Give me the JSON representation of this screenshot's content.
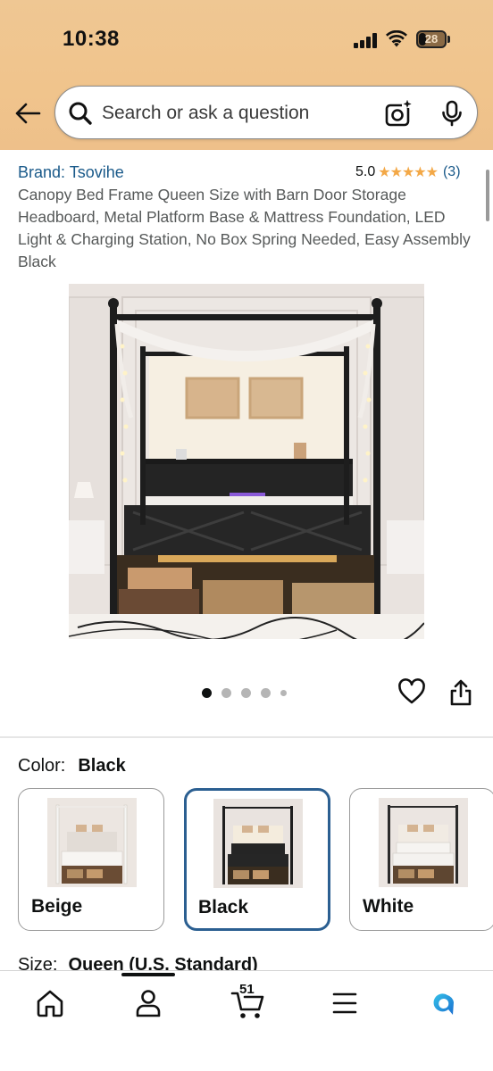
{
  "status_bar": {
    "time": "10:38",
    "battery": "28",
    "battery_level_percent": 28
  },
  "search": {
    "placeholder": "Search or ask a question"
  },
  "product": {
    "brand": "Brand: Tsovihe",
    "rating_value": "5.0",
    "rating_stars": "★★★★★",
    "rating_count": "(3)",
    "title": "Canopy Bed Frame Queen Size with Barn Door Storage Headboard, Metal Platform Base & Mattress Foundation, LED Light & Charging Station, No Box Spring Needed, Easy Assembly Black"
  },
  "carousel": {
    "total_images": 5,
    "active_index": 0
  },
  "color": {
    "label": "Color:",
    "selected": "Black",
    "options": [
      {
        "label": "Beige"
      },
      {
        "label": "Black"
      },
      {
        "label": "White"
      }
    ]
  },
  "size": {
    "label": "Size:",
    "selected": "Queen (U.S. Standard)"
  },
  "bottom_nav": {
    "cart_count": "51"
  },
  "colors": {
    "header": "#efc793",
    "link": "#1a5a8a",
    "star": "#f3a847",
    "selected_border": "#2b5f91",
    "alexa": "#1a8fd0"
  }
}
